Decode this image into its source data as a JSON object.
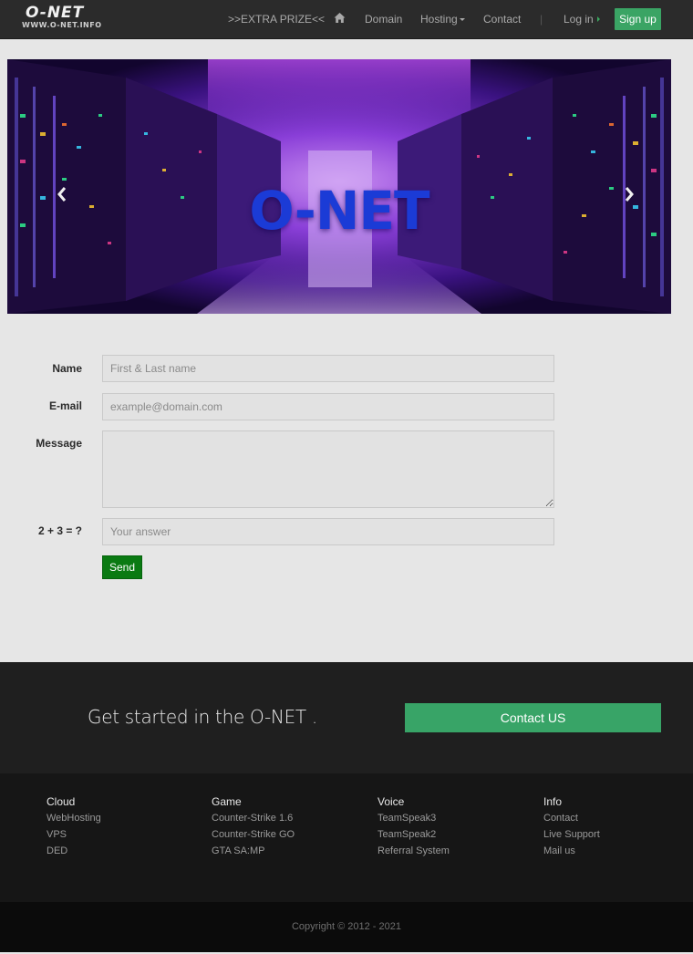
{
  "nav": {
    "logo_main": "O-NET",
    "logo_sub": "WWW.O-NET.INFO",
    "extra_prize": ">>EXTRA PRIZE<<",
    "home_icon": "home-icon",
    "domain": "Domain",
    "hosting": "Hosting",
    "contact": "Contact",
    "separator": "|",
    "login": "Log in",
    "signup": "Sign up"
  },
  "carousel": {
    "slide_title": "O-NET",
    "prev_icon": "chevron-left-icon",
    "next_icon": "chevron-right-icon"
  },
  "contact_form": {
    "name_label": "Name",
    "name_placeholder": "First & Last name",
    "email_label": "E-mail",
    "email_placeholder": "example@domain.com",
    "message_label": "Message",
    "message_value": "",
    "captcha_label": "2 + 3 = ?",
    "captcha_placeholder": "Your answer",
    "send_label": "Send"
  },
  "cta": {
    "text": "Get started in the O-NET .",
    "button": "Contact US"
  },
  "footer": {
    "columns": [
      {
        "title": "Cloud",
        "links": [
          "WebHosting",
          "VPS",
          "DED"
        ]
      },
      {
        "title": "Game",
        "links": [
          "Counter-Strike 1.6",
          "Counter-Strike GO",
          "GTA SA:MP"
        ]
      },
      {
        "title": "Voice",
        "links": [
          "TeamSpeak3",
          "TeamSpeak2",
          "Referral System"
        ]
      },
      {
        "title": "Info",
        "links": [
          "Contact",
          "Live Support",
          "Mail us"
        ]
      }
    ],
    "copyright": "Copyright © 2012 - 2021"
  },
  "colors": {
    "accent_green": "#3aa464",
    "send_green": "#0a7a12",
    "navbar_bg": "#2b2b2b",
    "page_bg": "#e6e6e6",
    "brand_blue": "#1b3bd6"
  }
}
